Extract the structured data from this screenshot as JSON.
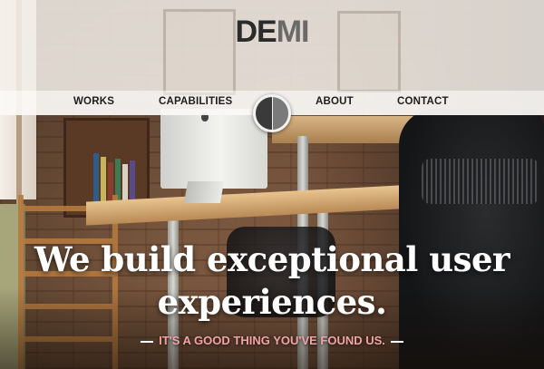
{
  "brand": {
    "logo_part1": "DE",
    "logo_part2": "MI",
    "logo_color_dark": "#2b2b2b",
    "logo_color_light": "#6a6a6a"
  },
  "nav": {
    "items": [
      {
        "label": "WORKS"
      },
      {
        "label": "CAPABILITIES"
      },
      {
        "label": "ABOUT"
      },
      {
        "label": "CONTACT"
      }
    ],
    "center_icon": "half-circle-dial-icon"
  },
  "hero": {
    "headline_line1": "We build exceptional user",
    "headline_line2": "experiences.",
    "tagline": "IT'S A GOOD THING YOU'VE FOUND US.",
    "tagline_color": "#f3a3a6"
  }
}
